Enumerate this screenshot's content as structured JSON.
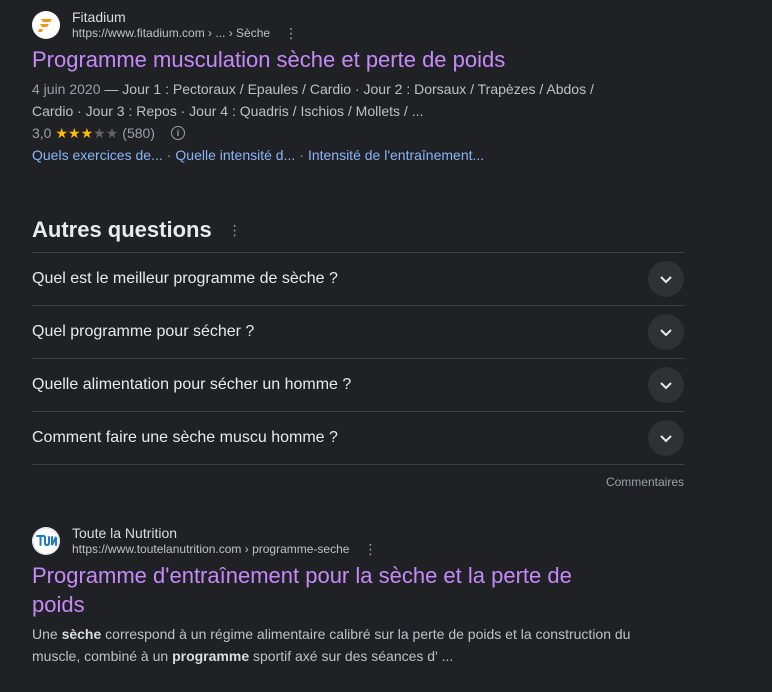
{
  "result1": {
    "site_name": "Fitadium",
    "url": "https://www.fitadium.com › ... › Sèche",
    "title": "Programme musculation sèche et perte de poids",
    "date": "4 juin 2020",
    "snippet_line1": " — Jour 1 : Pectoraux / Epaules / Cardio · Jour 2 : Dorsaux / Trapèzes / Abdos /",
    "snippet_line2": "Cardio · Jour 3 : Repos · Jour 4 : Quadris / Ischios / Mollets / ...",
    "rating_value": "3,0",
    "rating_stars": 3,
    "rating_max": 5,
    "rating_count": "(580)",
    "sitelinks": [
      "Quels exercices de...",
      "Quelle intensité d...",
      "Intensité de l'entraînement..."
    ]
  },
  "paa": {
    "title": "Autres questions",
    "questions": [
      "Quel est le meilleur programme de sèche ?",
      "Quel programme pour sécher ?",
      "Quelle alimentation pour sécher un homme ?",
      "Comment faire une sèche muscu homme ?"
    ],
    "feedback": "Commentaires"
  },
  "result2": {
    "site_name": "Toute la Nutrition",
    "url": "https://www.toutelanutrition.com › programme-seche",
    "title": "Programme d'entraînement pour la sèche et la perte de poids",
    "snippet": {
      "p1": "Une ",
      "b1": "sèche",
      "p2": " correspond à un régime alimentaire calibré sur la perte de poids et la construction du muscle, combiné à un ",
      "b2": "programme",
      "p3": " sportif axé sur des séances d' ..."
    }
  },
  "colors": {
    "background": "#202124",
    "visited_title": "#c58af9",
    "link": "#8ab4f8",
    "star": "#fbbc04",
    "fitadium_brand": "#f7941d",
    "tln_brand": "#1f7ac4"
  },
  "icons": [
    "fitadium-logo",
    "toutelanutrition-logo",
    "more-vert-icon",
    "info-icon",
    "chevron-down-icon",
    "star-icon"
  ]
}
